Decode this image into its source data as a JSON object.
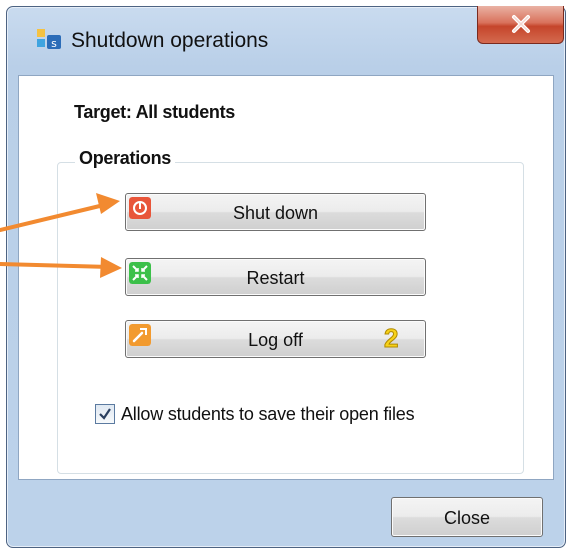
{
  "window": {
    "title": "Shutdown operations",
    "app_icon": "shutdown-app-icon",
    "close_icon": "close-icon"
  },
  "dialog": {
    "target_label": "Target: All students",
    "group_label": "Operations",
    "buttons": [
      {
        "label": "Shut down",
        "icon": "power-icon",
        "icon_color": "#e8553a"
      },
      {
        "label": "Restart",
        "icon": "restart-icon",
        "icon_color": "#3cc04a"
      },
      {
        "label": "Log off",
        "icon": "logoff-icon",
        "icon_color": "#f29a2e",
        "badge": "2"
      }
    ],
    "checkbox": {
      "label": "Allow students to save their open files",
      "checked": true
    },
    "close_button": "Close"
  },
  "annotations": {
    "arrow_color": "#f28a30",
    "arrows": [
      "arrow-to-shut-down",
      "arrow-to-restart"
    ]
  }
}
